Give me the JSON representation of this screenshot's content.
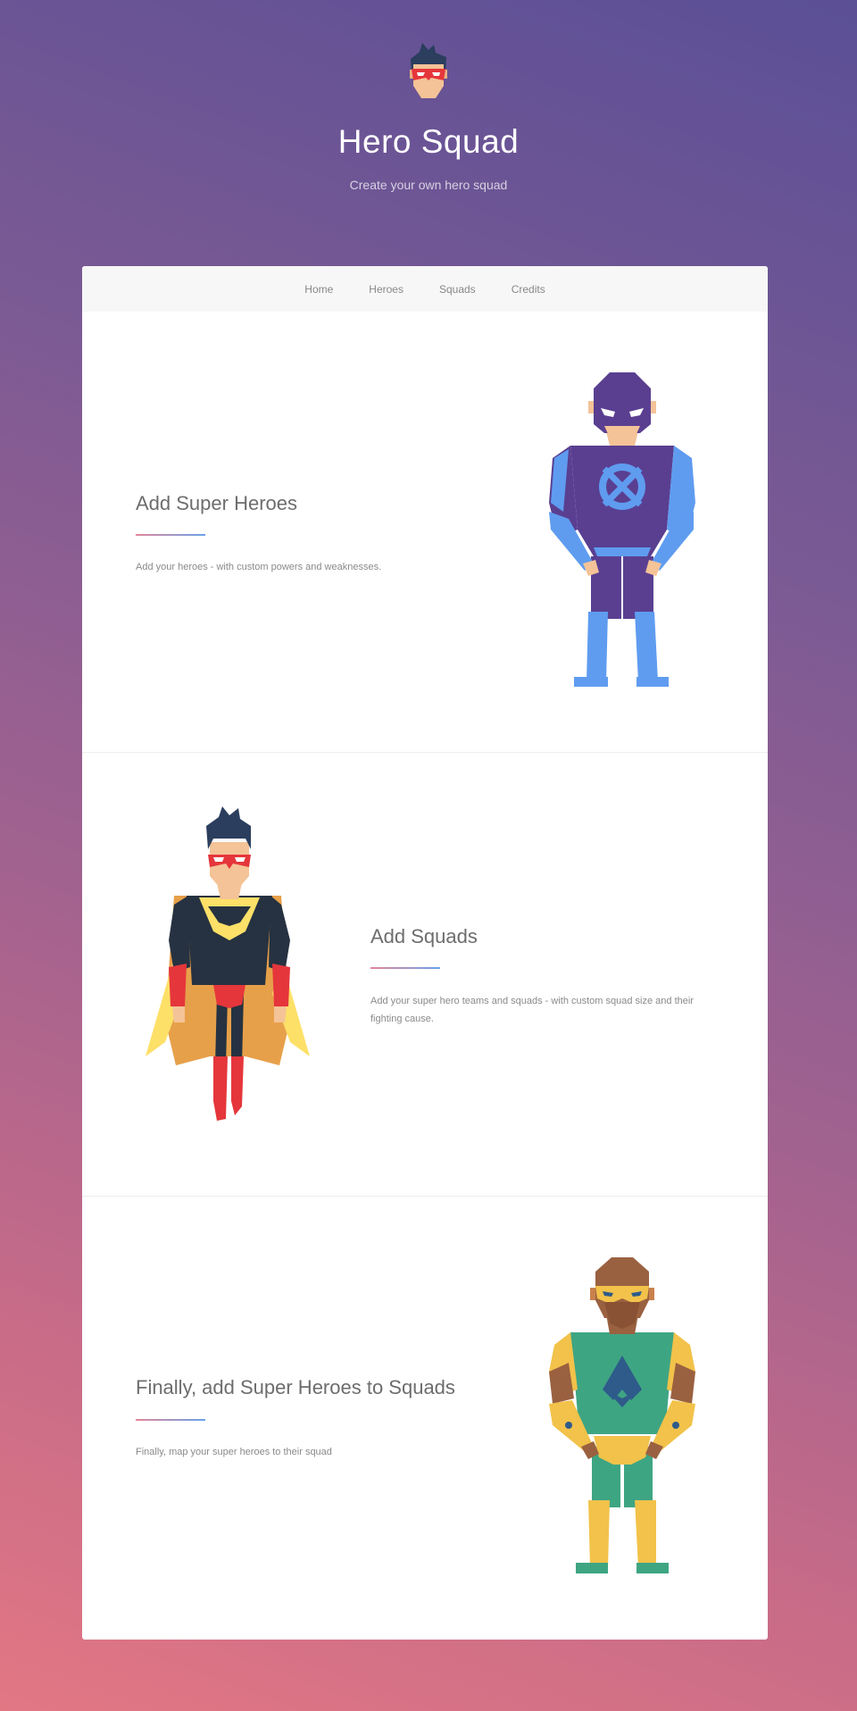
{
  "header": {
    "title": "Hero Squad",
    "tagline": "Create your own hero squad"
  },
  "nav": {
    "items": [
      {
        "label": "Home"
      },
      {
        "label": "Heroes"
      },
      {
        "label": "Squads"
      },
      {
        "label": "Credits"
      }
    ]
  },
  "sections": [
    {
      "title": "Add Super Heroes",
      "description": "Add your heroes - with custom powers and weaknesses.",
      "illustration": "purple-hero-illustration"
    },
    {
      "title": "Add Squads",
      "description": "Add your super hero teams and squads - with custom squad size and their fighting cause.",
      "illustration": "caped-hero-illustration"
    },
    {
      "title": "Finally, add Super Heroes to Squads",
      "description": "Finally, map your super heroes to their squad",
      "illustration": "green-hero-illustration"
    }
  ],
  "colors": {
    "background_top": "#5b4f96",
    "background_bottom": "#e27784",
    "accent_line_start": "#e2879a",
    "accent_line_end": "#6aa2e9"
  }
}
